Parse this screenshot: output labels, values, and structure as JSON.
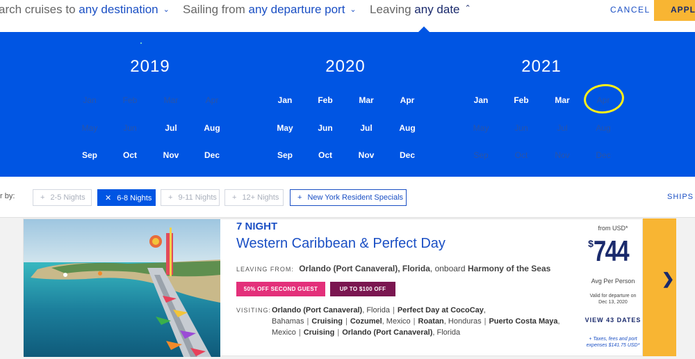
{
  "search": {
    "dest_prefix": "arch cruises to",
    "dest_value": "any destination",
    "port_prefix": "Sailing from",
    "port_value": "any departure port",
    "date_prefix": "Leaving",
    "date_value": "any date",
    "cancel": "CANCEL",
    "apply": "APPLY"
  },
  "calendar": {
    "years": [
      {
        "year": "2019",
        "months": [
          {
            "label": "Jan",
            "enabled": false
          },
          {
            "label": "Feb",
            "enabled": false
          },
          {
            "label": "Mar",
            "enabled": false
          },
          {
            "label": "Apr",
            "enabled": false
          },
          {
            "label": "May",
            "enabled": false
          },
          {
            "label": "Jun",
            "enabled": false
          },
          {
            "label": "Jul",
            "enabled": true
          },
          {
            "label": "Aug",
            "enabled": true
          },
          {
            "label": "Sep",
            "enabled": true
          },
          {
            "label": "Oct",
            "enabled": true
          },
          {
            "label": "Nov",
            "enabled": true
          },
          {
            "label": "Dec",
            "enabled": true
          }
        ]
      },
      {
        "year": "2020",
        "months": [
          {
            "label": "Jan",
            "enabled": true
          },
          {
            "label": "Feb",
            "enabled": true
          },
          {
            "label": "Mar",
            "enabled": true
          },
          {
            "label": "Apr",
            "enabled": true
          },
          {
            "label": "May",
            "enabled": true
          },
          {
            "label": "Jun",
            "enabled": true
          },
          {
            "label": "Jul",
            "enabled": true
          },
          {
            "label": "Aug",
            "enabled": true
          },
          {
            "label": "Sep",
            "enabled": true
          },
          {
            "label": "Oct",
            "enabled": true
          },
          {
            "label": "Nov",
            "enabled": true
          },
          {
            "label": "Dec",
            "enabled": true
          }
        ]
      },
      {
        "year": "2021",
        "months": [
          {
            "label": "Jan",
            "enabled": true
          },
          {
            "label": "Feb",
            "enabled": true
          },
          {
            "label": "Mar",
            "enabled": true
          },
          {
            "label": "Apr",
            "enabled": false
          },
          {
            "label": "May",
            "enabled": false
          },
          {
            "label": "Jun",
            "enabled": false
          },
          {
            "label": "Jul",
            "enabled": false
          },
          {
            "label": "Aug",
            "enabled": false
          },
          {
            "label": "Sep",
            "enabled": false
          },
          {
            "label": "Oct",
            "enabled": false
          },
          {
            "label": "Nov",
            "enabled": false
          },
          {
            "label": "Dec",
            "enabled": false
          }
        ]
      }
    ],
    "highlight_color": "#ffef1a",
    "background_color": "#0055e3"
  },
  "filters": {
    "label": "r by:",
    "chips": [
      {
        "label": "2-5 Nights",
        "icon": "plus-icon",
        "state": "disabled"
      },
      {
        "label": "6-8 Nights",
        "icon": "close-icon",
        "state": "selected"
      },
      {
        "label": "9-11 Nights",
        "icon": "plus-icon",
        "state": "disabled"
      },
      {
        "label": "12+ Nights",
        "icon": "plus-icon",
        "state": "disabled"
      },
      {
        "label": "New York Resident Specials",
        "icon": "plus-icon",
        "state": "available"
      }
    ],
    "ships": "SHIPS"
  },
  "cruise": {
    "nights": "7 NIGHT",
    "title": "Western Caribbean & Perfect Day",
    "leaving_label": "LEAVING FROM:",
    "port": "Orlando (Port Canaveral), Florida",
    "onboard_text": "onboard",
    "ship": "Harmony of the Seas",
    "badges": [
      {
        "text": "50% OFF SECOND GUEST",
        "color": "#e3307a"
      },
      {
        "text": "UP TO $100 OFF",
        "color": "#7a1650"
      }
    ],
    "visiting_label": "VISITING:",
    "ports": [
      {
        "name": "Orlando (Port Canaveral)",
        "region": "Florida"
      },
      {
        "name": "Perfect Day at CocoCay",
        "region": "Bahamas"
      },
      {
        "name": "Cruising",
        "region": ""
      },
      {
        "name": "Cozumel",
        "region": "Mexico"
      },
      {
        "name": "Roatan",
        "region": "Honduras"
      },
      {
        "name": "Puerto Costa Maya",
        "region": "Mexico"
      },
      {
        "name": "Cruising",
        "region": ""
      },
      {
        "name": "Orlando (Port Canaveral)",
        "region": "Florida"
      }
    ],
    "from_label": "from USD*",
    "currency": "$",
    "price": "744",
    "avg_label": "Avg Per Person",
    "valid_line1": "Valid for departure on",
    "valid_line2": "Dec 13, 2020",
    "view_dates": "VIEW 43 DATES",
    "taxes_line1": "+ Taxes, fees and port",
    "taxes_line2": "expenses $141.75 USD*"
  }
}
